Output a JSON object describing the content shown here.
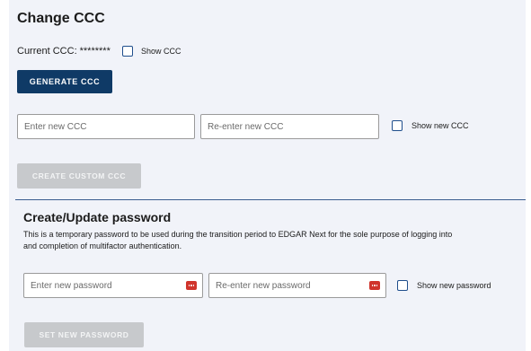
{
  "ccc_section": {
    "title": "Change CCC",
    "current_label": "Current CCC:",
    "current_value": "********",
    "show_ccc_label": "Show CCC",
    "generate_label": "GENERATE CCC",
    "new_ccc_placeholder": "Enter new CCC",
    "reenter_ccc_placeholder": "Re-enter new CCC",
    "show_new_ccc_label": "Show new CCC",
    "create_custom_label": "CREATE CUSTOM CCC"
  },
  "password_section": {
    "title": "Create/Update password",
    "description_line1": "This is a temporary password to be used during the transition period to EDGAR Next for the sole purpose of logging into",
    "description_line2": "and completion of multifactor authentication.",
    "new_password_placeholder": "Enter new password",
    "reenter_password_placeholder": "Re-enter new password",
    "show_new_password_label": "Show new password",
    "set_password_label": "SET NEW PASSWORD"
  },
  "colors": {
    "primary_button": "#0f3a66",
    "disabled_button": "#c7c9cc",
    "panel_background": "#f1f3f9",
    "password_manager_icon": "#d0342c"
  },
  "icons": {
    "password_field_icon": "password-manager-icon"
  }
}
